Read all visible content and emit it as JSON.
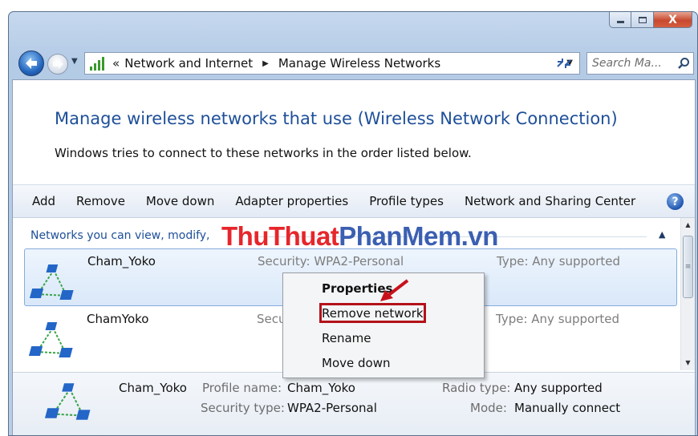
{
  "window": {
    "caption_buttons": {
      "minimize": "minimize",
      "maximize": "maximize",
      "close": "X"
    }
  },
  "nav": {
    "breadcrumbs": [
      "Network and Internet",
      "Manage Wireless Networks"
    ],
    "chevron": "«",
    "search_placeholder": "Search Ma...",
    "icons": {
      "back": "back-arrow-icon",
      "forward": "forward-arrow-icon",
      "refresh": "refresh-icon",
      "search": "magnifier-icon"
    }
  },
  "page": {
    "heading": "Manage wireless networks that use (Wireless Network Connection)",
    "subtext": "Windows tries to connect to these networks in the order listed below."
  },
  "toolbar": {
    "items": [
      "Add",
      "Remove",
      "Move down",
      "Adapter properties",
      "Profile types",
      "Network and Sharing Center"
    ],
    "help": "?"
  },
  "list": {
    "group_header": "Networks you can view, modify,",
    "networks": [
      {
        "name": "Cham_Yoko",
        "security": "Security:  WPA2-Personal",
        "type": "Type:  Any supported"
      },
      {
        "name": "ChamYoko",
        "security": "Secu",
        "type": "Type:  Any supported"
      }
    ]
  },
  "details": {
    "name": "Cham_Yoko",
    "profile_name_label": "Profile name:",
    "profile_name": "Cham_Yoko",
    "security_type_label": "Security type:",
    "security_type": "WPA2-Personal",
    "radio_type_label": "Radio type:",
    "radio_type": "Any supported",
    "mode_label": "Mode:",
    "mode": "Manually connect"
  },
  "context_menu": {
    "items": [
      "Properties",
      "Remove network",
      "Rename",
      "Move down"
    ]
  },
  "watermark": {
    "part1": "ThuThuat",
    "part2": "PhanMem",
    "part3": ".vn"
  },
  "colors": {
    "link_blue": "#1e4f99",
    "highlight_red": "#b3121a",
    "watermark_red": "#e6262b",
    "watermark_blue": "#3b5fb1"
  }
}
